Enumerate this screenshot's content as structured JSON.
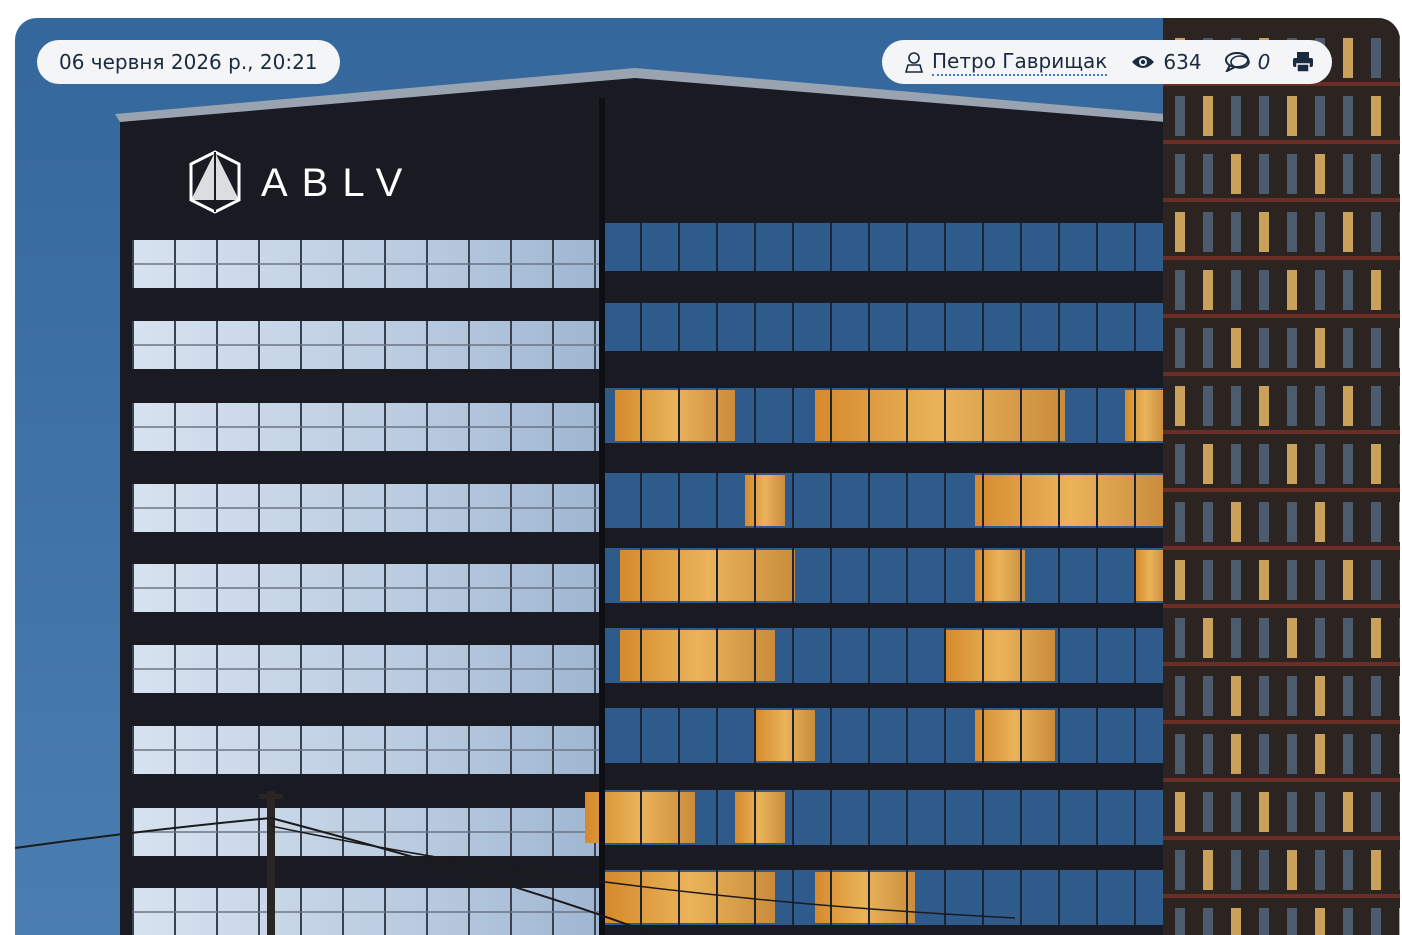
{
  "article": {
    "date": "06 червня 2026 р., 20:21",
    "author": "Петро Гаврищак",
    "views": "634",
    "comments": "0"
  },
  "photo": {
    "sign_text": "ABLV",
    "colors": {
      "sky": "#2f5f93",
      "facade_dark": "#1a1b22",
      "window_glass": "#c3d3e6",
      "window_warm": "#e6a448",
      "blue_glass": "#2e5a8c"
    }
  },
  "icons": {
    "author": "user-icon",
    "views": "eye-icon",
    "comments": "comment-icon",
    "print": "print-icon"
  }
}
